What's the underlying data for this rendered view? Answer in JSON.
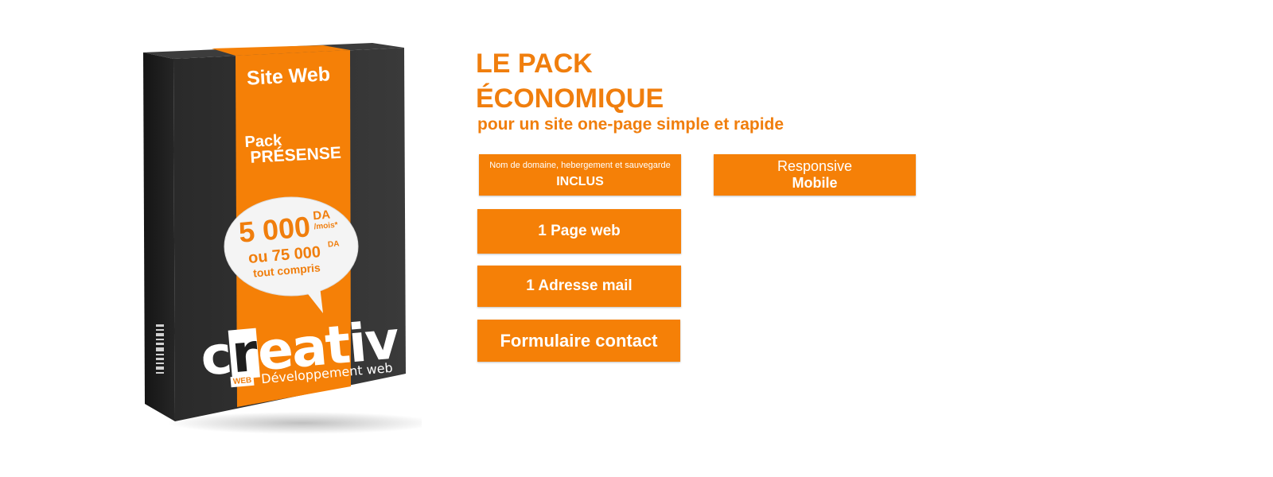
{
  "colors": {
    "accent": "#f58007",
    "box_dark": "#2e2e2e",
    "background": "#ffffff"
  },
  "box": {
    "label_site": "Site Web",
    "label_pack_line1": "Pack",
    "label_pack_line2": "PRÉSENSE",
    "price_main": "5 000",
    "price_main_unit": "DA",
    "price_main_period": "/mois*",
    "price_alt": "ou 75 000",
    "price_alt_unit": "DA",
    "price_note": "tout compris",
    "logo_text_c": "c",
    "logo_text_r": "r",
    "logo_text_rest": "eativ",
    "logo_badge": "WEB",
    "logo_tagline": "Développement web"
  },
  "heading": {
    "line1": "LE PACK",
    "line2": "ÉCONOMIQUE",
    "subtitle": "pour un site one-page simple et rapide"
  },
  "features": {
    "domain_small": "Nom de domaine, hebergement et sauvegarde",
    "domain_big": "INCLUS",
    "responsive_small": "Responsive",
    "responsive_big": "Mobile",
    "page": "1 Page web",
    "mail": "1 Adresse mail",
    "form": "Formulaire contact"
  }
}
